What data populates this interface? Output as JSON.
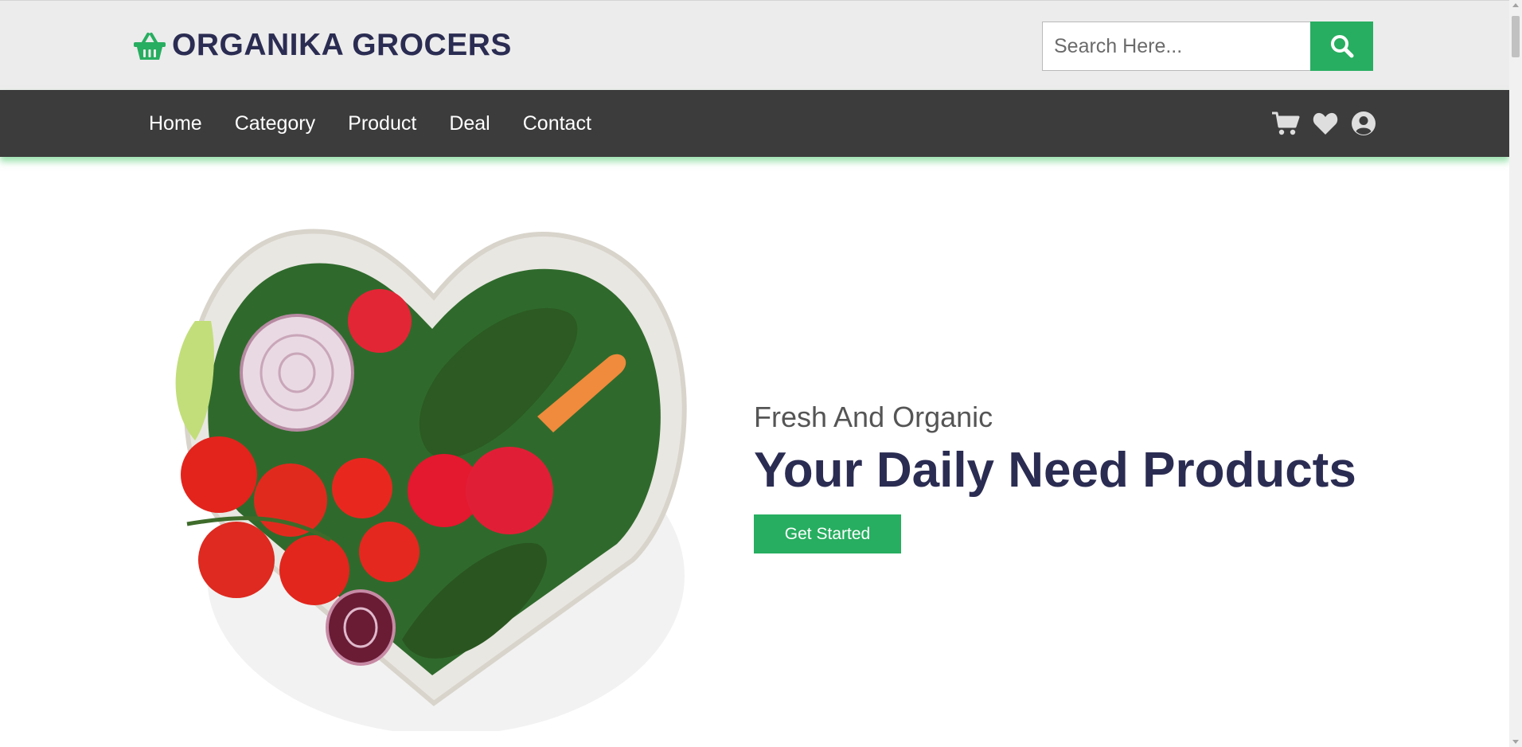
{
  "brand": {
    "name": "ORGANIKA GROCERS",
    "icon": "shopping-basket-icon",
    "color": "#27ae60"
  },
  "search": {
    "placeholder": "Search Here...",
    "value": "",
    "icon": "search-icon"
  },
  "nav": {
    "links": [
      "Home",
      "Category",
      "Product",
      "Deal",
      "Contact"
    ],
    "icons": [
      "cart-icon",
      "heart-icon",
      "user-circle-icon"
    ]
  },
  "hero": {
    "subtitle": "Fresh And Organic",
    "title": "Your Daily Need Products",
    "button_label": "Get Started",
    "image": "heart-shaped-vegetable-bowl-image"
  },
  "colors": {
    "accent": "#27ae60",
    "heading": "#2b2c52",
    "navbar": "#3c3c3c",
    "header_bg": "#ececec"
  }
}
